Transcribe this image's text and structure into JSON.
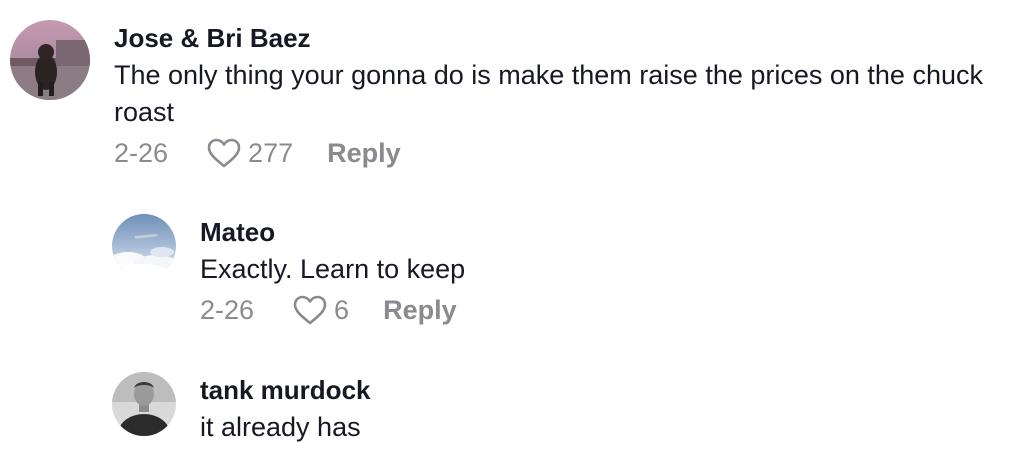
{
  "comments": [
    {
      "username": "Jose & Bri Baez",
      "text": "The only thing your gonna do is make them raise the prices on the chuck roast",
      "date": "2-26",
      "likes": "277",
      "reply_label": "Reply",
      "avatar_icon": "dog-photo-avatar"
    },
    {
      "username": "Mateo",
      "text": "Exactly. Learn to keep",
      "date": "2-26",
      "likes": "6",
      "reply_label": "Reply",
      "avatar_icon": "sky-clouds-avatar"
    },
    {
      "username": "tank murdock",
      "text": "it already has",
      "avatar_icon": "person-photo-avatar"
    }
  ],
  "colors": {
    "text": "#161823",
    "meta": "#8a8b91",
    "background": "#ffffff"
  }
}
